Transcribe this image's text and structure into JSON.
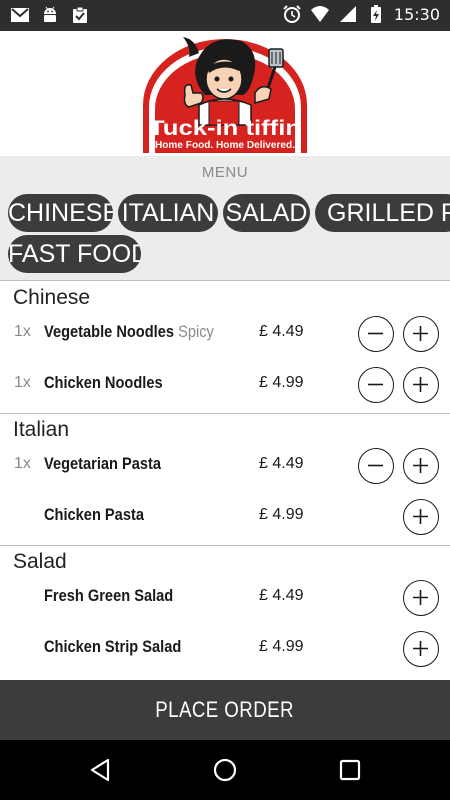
{
  "status_bar": {
    "time": "15:30",
    "left_icons": [
      "gmail-icon",
      "android-icon",
      "clipboard-check-icon"
    ],
    "right_icons": [
      "alarm-icon",
      "wifi-icon",
      "signal-icon",
      "battery-charging-icon"
    ]
  },
  "header": {
    "brand": "Tuck-in tiffin",
    "tagline": "Home Food. Home Delivered.",
    "brand_color": "#d6231f"
  },
  "menu": {
    "label": "MENU",
    "categories": [
      "CHINESE",
      "ITALIAN",
      "SALAD",
      "GRILLED FOOD",
      "FAST FOOD"
    ]
  },
  "sections": [
    {
      "title": "Chinese",
      "items": [
        {
          "qty": "1x",
          "name": "Vegetable Noodles",
          "tag": "Spicy",
          "price": "£ 4.49"
        },
        {
          "qty": "1x",
          "name": "Chicken Noodles",
          "tag": "",
          "price": "£ 4.99"
        }
      ]
    },
    {
      "title": "Italian",
      "items": [
        {
          "qty": "1x",
          "name": "Vegetarian Pasta",
          "tag": "",
          "price": "£ 4.49"
        },
        {
          "qty": "",
          "name": "Chicken Pasta",
          "tag": "",
          "price": "£ 4.99"
        }
      ]
    },
    {
      "title": "Salad",
      "items": [
        {
          "qty": "",
          "name": "Fresh Green Salad",
          "tag": "",
          "price": "£ 4.49"
        },
        {
          "qty": "",
          "name": "Chicken Strip Salad",
          "tag": "",
          "price": "£ 4.99"
        }
      ]
    }
  ],
  "place_order": {
    "label": "PLACE ORDER"
  },
  "nav_bar": {
    "icons": [
      "back-icon",
      "home-icon",
      "recents-icon"
    ]
  }
}
